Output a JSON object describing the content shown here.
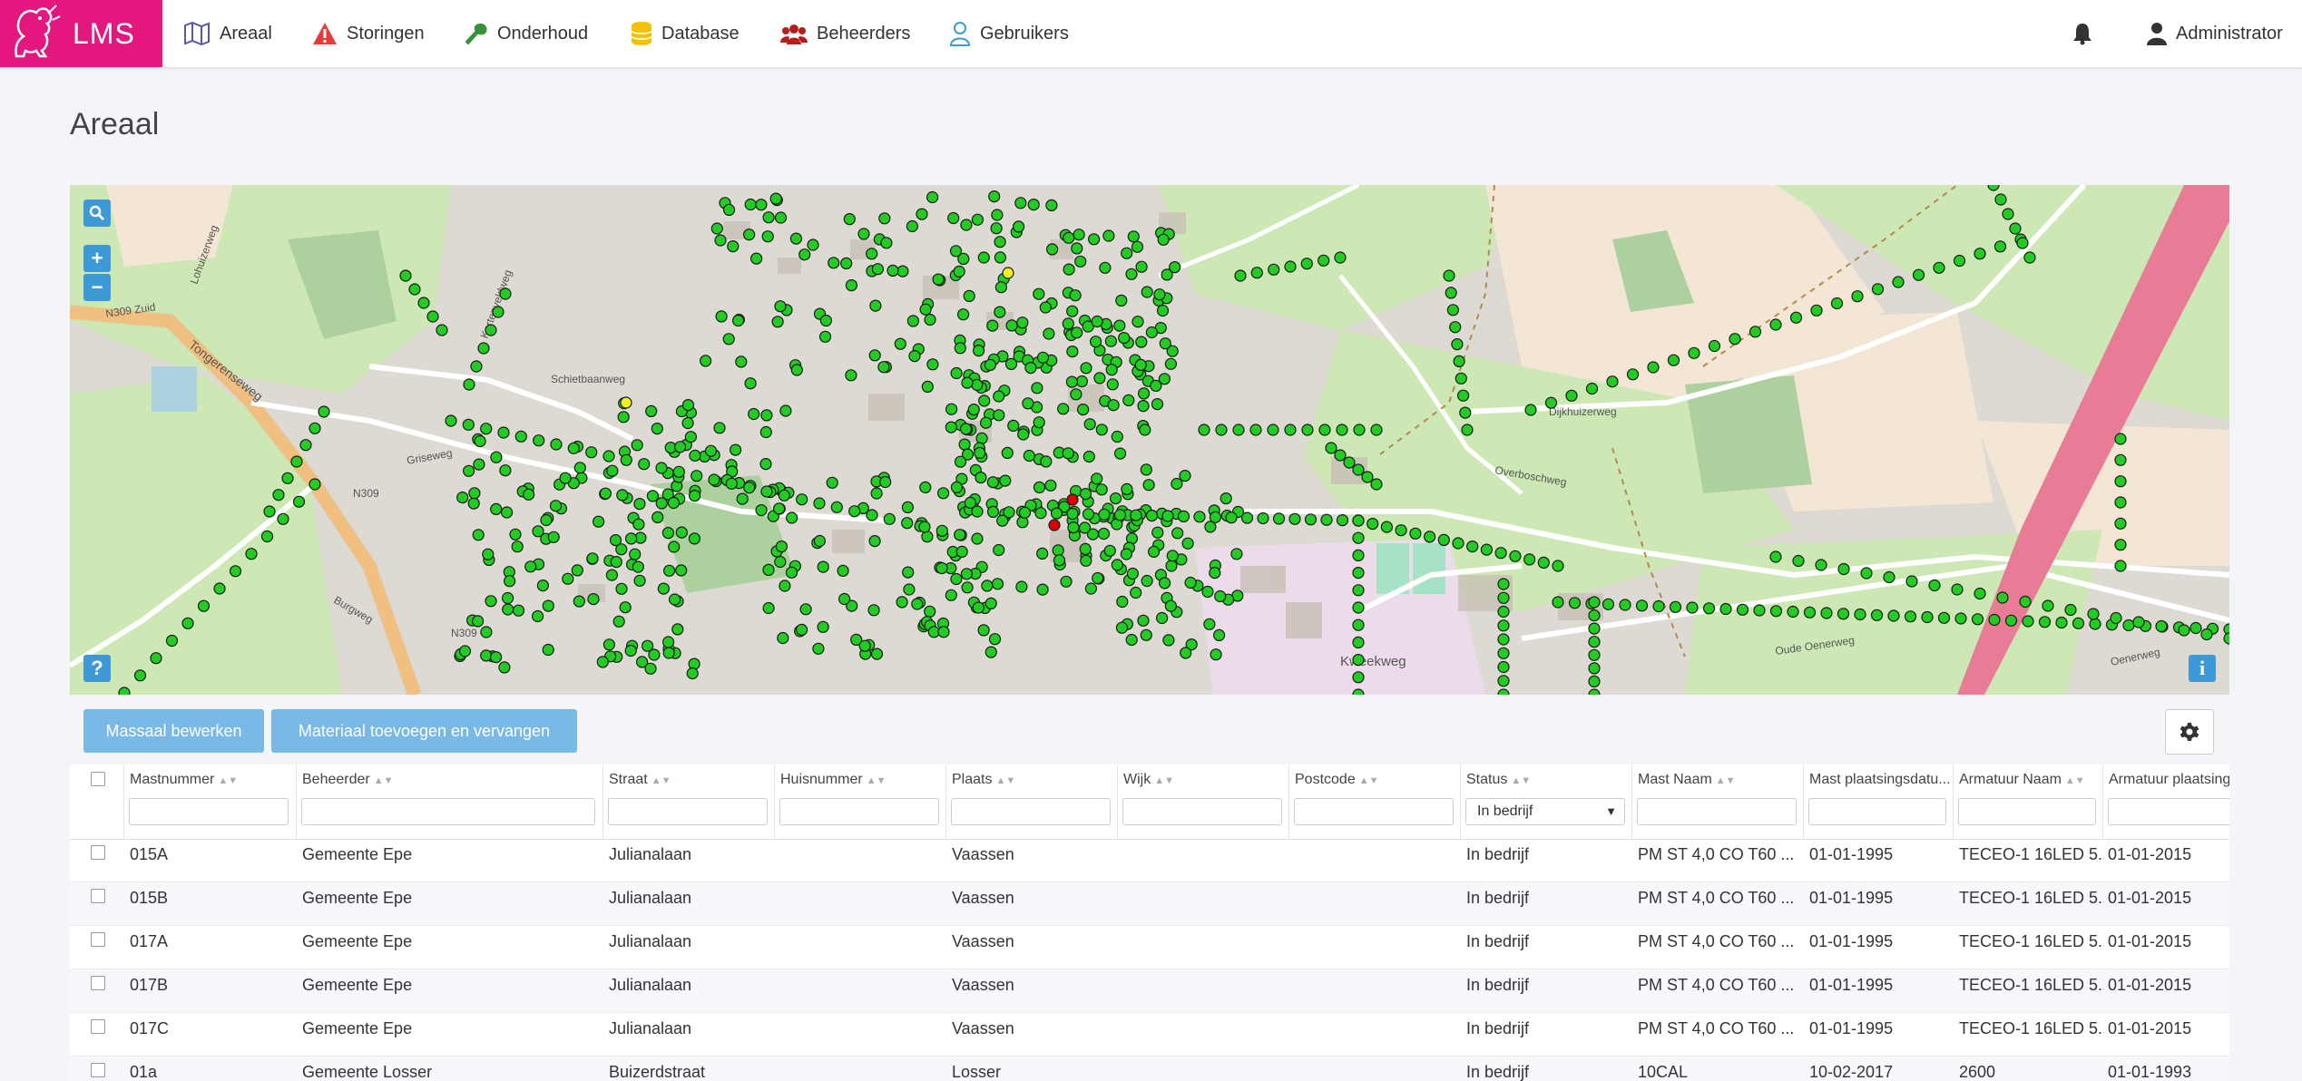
{
  "app": {
    "brand": "LMS"
  },
  "nav": {
    "items": [
      {
        "label": "Areaal",
        "icon": "map-icon"
      },
      {
        "label": "Storingen",
        "icon": "warning-icon"
      },
      {
        "label": "Onderhoud",
        "icon": "wrench-icon"
      },
      {
        "label": "Database",
        "icon": "database-icon"
      },
      {
        "label": "Beheerders",
        "icon": "users-icon"
      },
      {
        "label": "Gebruikers",
        "icon": "user-icon"
      }
    ],
    "notifications_icon": "bell-icon",
    "user": {
      "label": "Administrator",
      "icon": "user-icon"
    }
  },
  "page": {
    "title": "Areaal"
  },
  "map": {
    "labels": {
      "n309_zuid": "N309 Zuid",
      "tongerenseweg": "Tongerenseweg",
      "n309_a": "N309",
      "n309_b": "N309",
      "griseweg": "Griseweg",
      "burgweg": "Burgweg",
      "schietbaanweg": "Schietbaanweg",
      "dijkhuizerweg": "Dijkhuizerweg",
      "overboschweg": "Overboschweg",
      "oude_oenerweg": "Oude Oenerweg",
      "oenerweg": "Oenerweg",
      "kweekweg": "Kweekweg",
      "lohuizerweg": "Lohuizerweg",
      "kortenveldweg": "Kortenveldweg"
    },
    "controls": {
      "search_icon": "search-icon",
      "zoom_in": "+",
      "zoom_out": "−",
      "help": "?",
      "info": "i"
    },
    "marker_colors": {
      "active": "#22cc22",
      "warning": "#eeee22",
      "fault": "#dd0000"
    }
  },
  "toolbar": {
    "bulk_edit": "Massaal bewerken",
    "add_replace": "Materiaal toevoegen en vervangen",
    "settings_icon": "gear-icon"
  },
  "table": {
    "columns": [
      {
        "label": "Mastnummer",
        "filter": ""
      },
      {
        "label": "Beheerder",
        "filter": ""
      },
      {
        "label": "Straat",
        "filter": ""
      },
      {
        "label": "Huisnummer",
        "filter": ""
      },
      {
        "label": "Plaats",
        "filter": ""
      },
      {
        "label": "Wijk",
        "filter": ""
      },
      {
        "label": "Postcode",
        "filter": ""
      },
      {
        "label": "Status",
        "filter": "In bedrijf"
      },
      {
        "label": "Mast Naam",
        "filter": ""
      },
      {
        "label": "Mast plaatsingsdatu...",
        "filter": ""
      },
      {
        "label": "Armatuur Naam",
        "filter": ""
      },
      {
        "label": "Armatuur plaatsing",
        "filter": ""
      }
    ],
    "rows": [
      [
        "015A",
        "Gemeente Epe",
        "Julianalaan",
        "",
        "Vaassen",
        "",
        "",
        "In bedrijf",
        "PM ST 4,0 CO T60 ...",
        "01-01-1995",
        "TECEO-1 16LED 5...",
        "01-01-2015"
      ],
      [
        "015B",
        "Gemeente Epe",
        "Julianalaan",
        "",
        "Vaassen",
        "",
        "",
        "In bedrijf",
        "PM ST 4,0 CO T60 ...",
        "01-01-1995",
        "TECEO-1 16LED 5...",
        "01-01-2015"
      ],
      [
        "017A",
        "Gemeente Epe",
        "Julianalaan",
        "",
        "Vaassen",
        "",
        "",
        "In bedrijf",
        "PM ST 4,0 CO T60 ...",
        "01-01-1995",
        "TECEO-1 16LED 5...",
        "01-01-2015"
      ],
      [
        "017B",
        "Gemeente Epe",
        "Julianalaan",
        "",
        "Vaassen",
        "",
        "",
        "In bedrijf",
        "PM ST 4,0 CO T60 ...",
        "01-01-1995",
        "TECEO-1 16LED 5...",
        "01-01-2015"
      ],
      [
        "017C",
        "Gemeente Epe",
        "Julianalaan",
        "",
        "Vaassen",
        "",
        "",
        "In bedrijf",
        "PM ST 4,0 CO T60 ...",
        "01-01-1995",
        "TECEO-1 16LED 5...",
        "01-01-2015"
      ],
      [
        "01a",
        "Gemeente Losser",
        "Buizerdstraat",
        "",
        "Losser",
        "",
        "",
        "In bedrijf",
        "10CAL",
        "10-02-2017",
        "2600",
        "01-01-1993"
      ]
    ]
  }
}
